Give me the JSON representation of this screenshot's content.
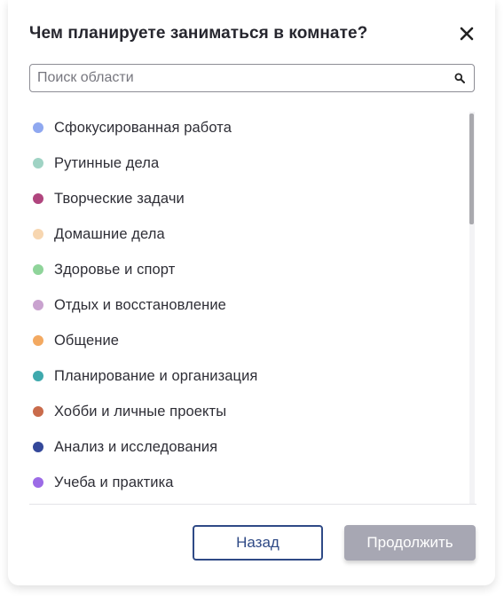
{
  "dialog": {
    "title": "Чем планируете заниматься в комнате?",
    "close_icon": "close-icon"
  },
  "search": {
    "placeholder": "Поиск области",
    "value": "",
    "icon": "search-icon"
  },
  "categories": [
    {
      "label": "Сфокусированная работа",
      "color": "#8fa8f0"
    },
    {
      "label": "Рутинные дела",
      "color": "#9fd3c4"
    },
    {
      "label": "Творческие задачи",
      "color": "#b0457e"
    },
    {
      "label": "Домашние дела",
      "color": "#f7d6b0"
    },
    {
      "label": "Здоровье и спорт",
      "color": "#8fd49a"
    },
    {
      "label": "Отдых и восстановление",
      "color": "#c9a2cf"
    },
    {
      "label": "Общение",
      "color": "#f3a961"
    },
    {
      "label": "Планирование и организация",
      "color": "#3fa9ad"
    },
    {
      "label": "Хобби и личные проекты",
      "color": "#c96b4b"
    },
    {
      "label": "Анализ и исследования",
      "color": "#34489a"
    },
    {
      "label": "Учеба и практика",
      "color": "#9c6be6"
    }
  ],
  "buttons": {
    "back_label": "Назад",
    "continue_label": "Продолжить"
  }
}
